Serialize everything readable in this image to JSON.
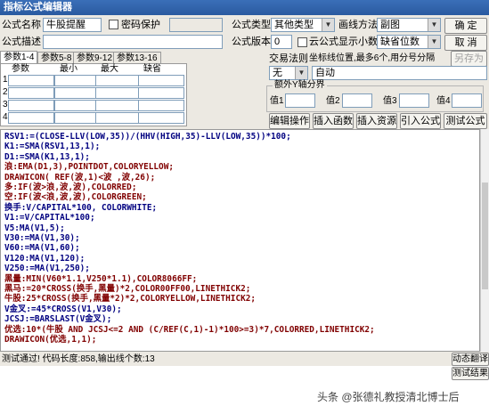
{
  "window": {
    "title": "指标公式编辑器"
  },
  "form": {
    "name_label": "公式名称",
    "name_value": "牛股提醒",
    "password_label": "密码保护",
    "desc_label": "公式描述",
    "desc_value": "",
    "type_label": "公式类型",
    "type_value": "其他类型",
    "draw_label": "画线方法",
    "draw_value": "副图",
    "version_label": "公式版本",
    "version_value": "0",
    "cloud_label": "云公式",
    "decimals_label": "显示小数",
    "decimals_value": "缺省位数",
    "trade_rule_label": "交易法则",
    "coord_label": "坐标线位置,最多6个,用分号分隔",
    "trade_rule_value": "无",
    "coord_value": "自动",
    "extra_label": "额外Y轴分界",
    "val_labels": [
      "值1",
      "值2",
      "值3",
      "值4"
    ]
  },
  "buttons": {
    "ok": "确 定",
    "cancel": "取 消",
    "save_as": "另存为",
    "edit_op": "编辑操作",
    "insert_func": "插入函数",
    "insert_res": "插入资源",
    "import": "引入公式",
    "test": "测试公式",
    "dynamic_translate": "动态翻译",
    "test_result": "测试结果"
  },
  "tabs": [
    "参数1-4",
    "参数5-8",
    "参数9-12",
    "参数13-16"
  ],
  "param_grid": {
    "headers": [
      "参数",
      "最小",
      "最大",
      "缺省"
    ],
    "rows": [
      "1",
      "2",
      "3",
      "4"
    ]
  },
  "code": [
    {
      "t": "RSV1:=(CLOSE-LLV(LOW,35))/(HHV(HIGH,35)-LLV(LOW,35))*100;",
      "c": "#000080"
    },
    {
      "t": "K1:=SMA(RSV1,13,1);",
      "c": "#000080"
    },
    {
      "t": "D1:=SMA(K1,13,1);",
      "c": "#000080"
    },
    {
      "t": "浪:EMA(D1,3),POINTDOT,COLORYELLOW;",
      "c": "#800000"
    },
    {
      "t": "DRAWICON( REF(波,1)<波 ,波,26);",
      "c": "#800000"
    },
    {
      "t": "多:IF(波>浪,波,波),COLORRED;",
      "c": "#800000"
    },
    {
      "t": "空:IF(波<浪,波,波),COLORGREEN;",
      "c": "#800000"
    },
    {
      "t": "换手:V/CAPITAL*100, COLORWHITE;",
      "c": "#000080"
    },
    {
      "t": "V1:=V/CAPITAL*100;",
      "c": "#000080"
    },
    {
      "t": "V5:MA(V1,5);",
      "c": "#000080"
    },
    {
      "t": "V30:=MA(V1,30);",
      "c": "#000080"
    },
    {
      "t": "V60:=MA(V1,60);",
      "c": "#000080"
    },
    {
      "t": "V120:MA(V1,120);",
      "c": "#000080"
    },
    {
      "t": "V250:=MA(V1,250);",
      "c": "#000080"
    },
    {
      "t": "黑量:MIN(V60*1.1,V250*1.1),COLOR8066FF;",
      "c": "#800000"
    },
    {
      "t": "黑马:=20*CROSS(换手,黑量)*2,COLOR00FF00,LINETHICK2;",
      "c": "#800000"
    },
    {
      "t": "牛股:25*CROSS(换手,黑量*2)*2,COLORYELLOW,LINETHICK2;",
      "c": "#800000"
    },
    {
      "t": "V金叉:=45*CROSS(V1,V30);",
      "c": "#000080"
    },
    {
      "t": "JCSJ:=BARSLAST(V金叉);",
      "c": "#000080"
    },
    {
      "t": "优选:10*(牛股 AND JCSJ<=2 AND (C/REF(C,1)-1)*100>=3)*7,COLORRED,LINETHICK2;",
      "c": "#800000"
    },
    {
      "t": "DRAWICON(优选,1,1);",
      "c": "#800000"
    }
  ],
  "status_text": "测试通过! 代码长度:858,输出线个数:13",
  "watermark": "头条 @张德礼教授清北博士后"
}
